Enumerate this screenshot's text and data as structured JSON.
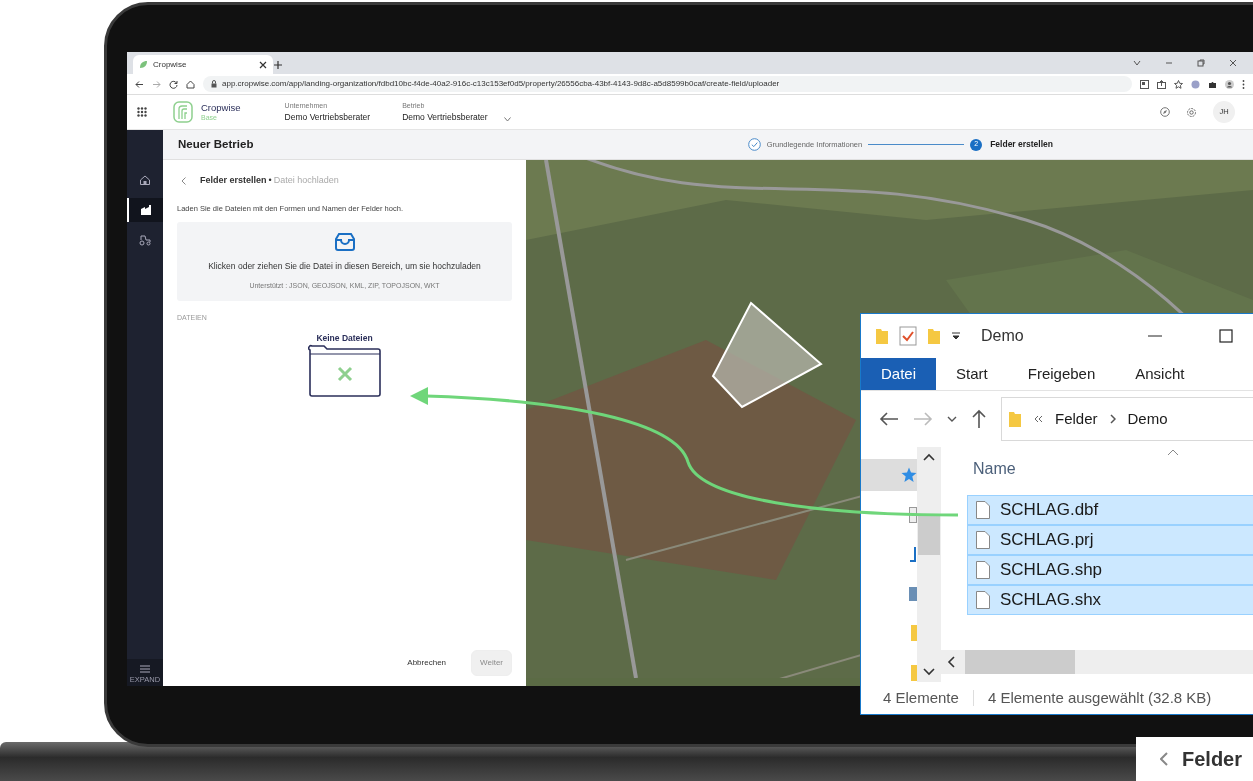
{
  "browser": {
    "tab_title": "Cropwise",
    "url": "app.cropwise.com/app/landing-organization/fdbd10bc-f4de-40a2-916c-c13c153ef0d5/property/26556cba-43bf-4143-9d8c-a5d8599b0caf/create-field/uploader"
  },
  "app_header": {
    "logo_name": "Cropwise",
    "logo_sub": "Base",
    "selectors": [
      {
        "label": "Unternehmen",
        "value": "Demo Vertriebsberater",
        "dropdown": false
      },
      {
        "label": "Betrieb",
        "value": "Demo Vertriebsberater",
        "dropdown": true
      }
    ],
    "avatar": "JH"
  },
  "sidebar": {
    "items": [
      {
        "kind": "home",
        "selected": false
      },
      {
        "kind": "farm",
        "selected": true
      },
      {
        "kind": "tractor",
        "selected": false
      }
    ],
    "expand_label": "EXPAND"
  },
  "page_title": "Neuer Betrieb",
  "steps": [
    {
      "label": "Grundlegende Informationen",
      "completed": true,
      "selected": false
    },
    {
      "number": "2",
      "label": "Felder erstellen",
      "completed": false,
      "selected": true
    }
  ],
  "panel": {
    "title": "Felder erstellen",
    "separator": "•",
    "subtitle": "Datei hochladen",
    "instruction": "Laden Sie die Dateien mit den Formen und Namen der Felder hoch.",
    "dropzone": {
      "text": "Klicken oder ziehen Sie die Datei in diesen Bereich, um sie hochzuladen",
      "supported": "Unterstützt : JSON, GEOJSON, KML, ZIP, TOPOJSON, WKT"
    },
    "files_label": "DATEIEN",
    "empty_text": "Keine Dateien",
    "buttons": [
      {
        "label": "Abbrechen",
        "kind": "link",
        "disabled": false
      },
      {
        "label": "Weiter",
        "kind": "primary",
        "disabled": true
      }
    ]
  },
  "explorer": {
    "title": "Demo",
    "ribbon_tabs": [
      {
        "label": "Datei",
        "selected": true
      },
      {
        "label": "Start",
        "selected": false
      },
      {
        "label": "Freigeben",
        "selected": false
      },
      {
        "label": "Ansicht",
        "selected": false
      }
    ],
    "path": [
      "Felder",
      "Demo"
    ],
    "column": "Name",
    "files": [
      {
        "name": "SCHLAG.dbf",
        "selected": true
      },
      {
        "name": "SCHLAG.prj",
        "selected": true
      },
      {
        "name": "SCHLAG.shp",
        "selected": true
      },
      {
        "name": "SCHLAG.shx",
        "selected": true
      }
    ],
    "status_count": "4 Elemente",
    "status_selection": "4 Elemente ausgewählt (32.8 KB)"
  },
  "corner_preview": {
    "title": "Felder"
  }
}
